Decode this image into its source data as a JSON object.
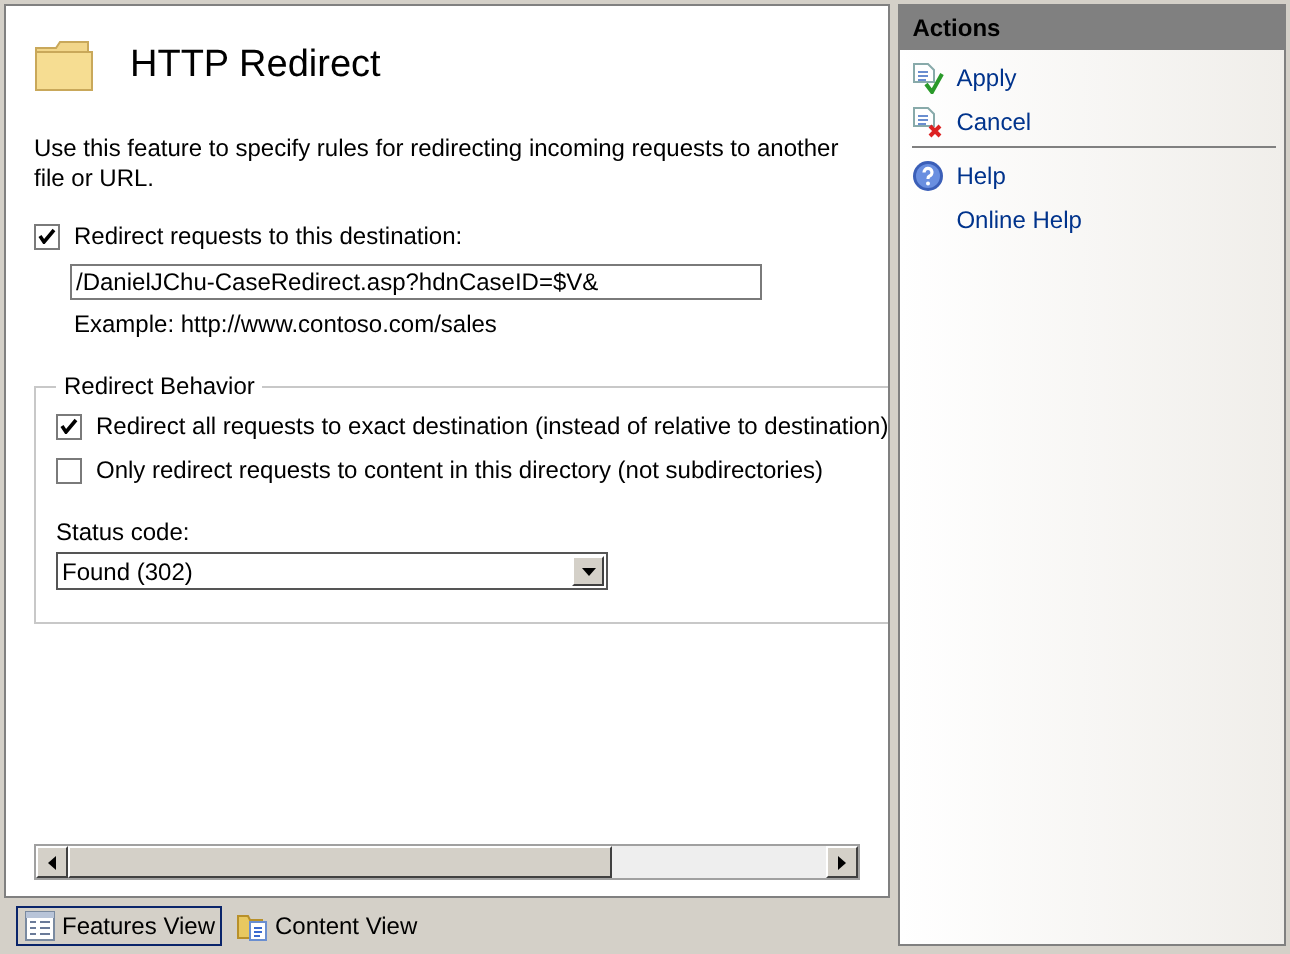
{
  "page": {
    "title": "HTTP Redirect",
    "description": "Use this feature to specify rules for redirecting incoming requests to another file or URL."
  },
  "destination": {
    "label": "Redirect requests to this destination:",
    "checked": true,
    "value": "/DanielJChu-CaseRedirect.asp?hdnCaseID=$V&",
    "example": "Example: http://www.contoso.com/sales"
  },
  "behavior": {
    "title": "Redirect Behavior",
    "options": [
      {
        "label": "Redirect all requests to exact destination (instead of relative to destination)",
        "checked": true
      },
      {
        "label": "Only redirect requests to content in this directory (not subdirectories)",
        "checked": false
      }
    ],
    "status_label": "Status code:",
    "status_value": "Found (302)"
  },
  "view_tabs": [
    {
      "label": "Features View",
      "selected": true,
      "kind": "features"
    },
    {
      "label": "Content View",
      "selected": false,
      "kind": "content"
    }
  ],
  "actions": {
    "title": "Actions",
    "items": [
      {
        "label": "Apply",
        "kind": "apply"
      },
      {
        "label": "Cancel",
        "kind": "cancel"
      },
      {
        "kind": "separator"
      },
      {
        "label": "Help",
        "kind": "help"
      },
      {
        "label": "Online Help",
        "kind": "link"
      }
    ]
  }
}
